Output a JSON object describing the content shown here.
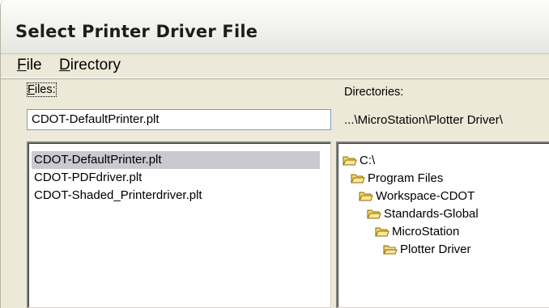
{
  "window": {
    "title": "Select Printer Driver File"
  },
  "menu": [
    {
      "pre": "",
      "accel": "F",
      "post": "ile"
    },
    {
      "pre": "",
      "accel": "D",
      "post": "irectory"
    }
  ],
  "files": {
    "label_accel": "F",
    "label_rest": "iles:",
    "filename_value": "CDOT-DefaultPrinter.plt",
    "items": [
      "CDOT-DefaultPrinter.plt",
      "CDOT-PDFdriver.plt",
      "CDOT-Shaded_Printerdriver.plt"
    ],
    "selected_index": 0
  },
  "directories": {
    "label": "Directories:",
    "current_path": "...\\MicroStation\\Plotter Driver\\",
    "tree": [
      {
        "name": "C:\\",
        "icon": "folder-icon",
        "depth": 0
      },
      {
        "name": "Program Files",
        "icon": "folder-icon",
        "depth": 1
      },
      {
        "name": "Workspace-CDOT",
        "icon": "folder-icon",
        "depth": 2
      },
      {
        "name": "Standards-Global",
        "icon": "folder-icon",
        "depth": 3
      },
      {
        "name": "MicroStation",
        "icon": "folder-icon",
        "depth": 4
      },
      {
        "name": "Plotter Driver",
        "icon": "open-folder-icon",
        "depth": 5
      }
    ]
  },
  "colors": {
    "window_bg": "#ece9d8",
    "selection": "#c9c9cf",
    "folder_fill": "#f5d66a",
    "folder_stroke": "#8a6d00"
  }
}
